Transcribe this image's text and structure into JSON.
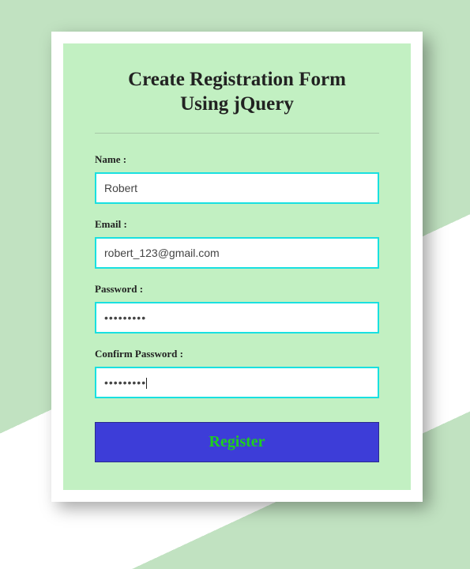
{
  "title_line1": "Create Registration Form",
  "title_line2": "Using jQuery",
  "fields": {
    "name": {
      "label": "Name :",
      "value": "Robert"
    },
    "email": {
      "label": "Email :",
      "value": "robert_123@gmail.com"
    },
    "password": {
      "label": "Password :",
      "value": "•••••••••"
    },
    "confirm": {
      "label": "Confirm Password :",
      "value": "•••••••••"
    }
  },
  "button": {
    "label": "Register"
  },
  "colors": {
    "accent_border": "#19e0e0",
    "button_bg": "#3d3dd8",
    "button_text": "#1ecf1e",
    "panel_bg": "#c2f0c2",
    "page_bg": "#c1e2c1"
  }
}
